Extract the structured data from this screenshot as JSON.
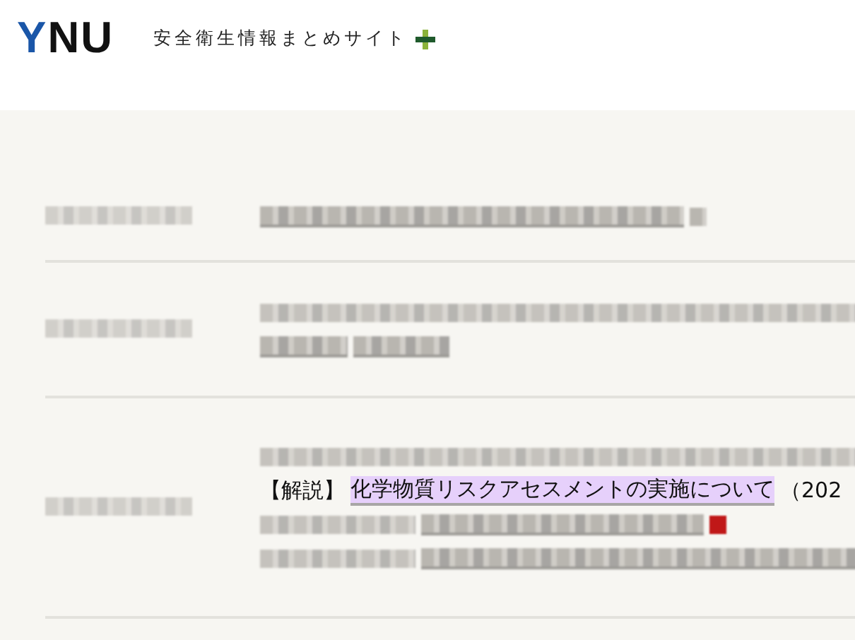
{
  "header": {
    "logo": "YNU",
    "site_title": "安全衛生情報まとめサイト"
  },
  "news": [
    {
      "date": {
        "kind": "blurred"
      },
      "lines": [
        [
          {
            "kind": "blurred-link"
          },
          {
            "kind": "blurred-icon"
          }
        ]
      ]
    },
    {
      "date": {
        "kind": "blurred"
      },
      "lines": [
        [
          {
            "kind": "blurred"
          }
        ],
        [
          {
            "kind": "blurred-link"
          },
          {
            "kind": "blurred-link"
          }
        ]
      ]
    },
    {
      "date": {
        "kind": "blurred"
      },
      "lines": [
        [
          {
            "kind": "blurred"
          }
        ],
        [
          {
            "kind": "text",
            "text": "【解説】"
          },
          {
            "kind": "link",
            "text": "化学物質リスクアセスメントの実施について",
            "highlighted": true
          },
          {
            "kind": "text",
            "text": "（202"
          }
        ],
        [
          {
            "kind": "blurred"
          },
          {
            "kind": "blurred-link"
          },
          {
            "kind": "blurred-badge"
          }
        ],
        [
          {
            "kind": "blurred"
          },
          {
            "kind": "blurred-link"
          }
        ]
      ]
    }
  ]
}
